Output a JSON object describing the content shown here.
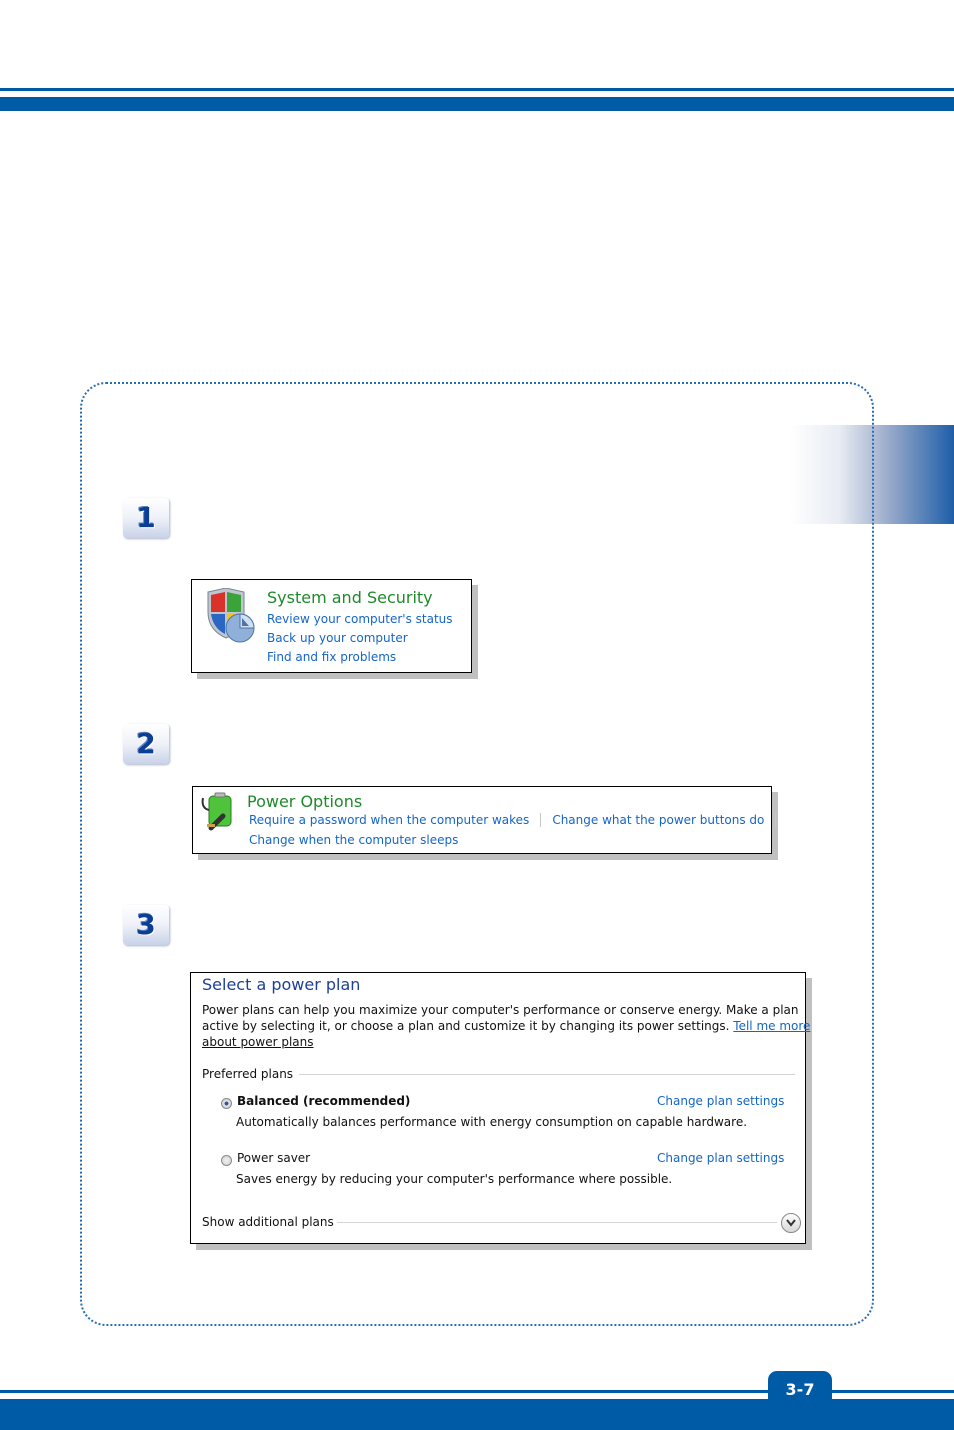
{
  "page": {
    "number": "3-7",
    "colors": {
      "brand_blue": "#005ba6",
      "link_blue": "#1565c7",
      "green_title": "#1e8a2a"
    }
  },
  "steps": [
    {
      "number": "1"
    },
    {
      "number": "2"
    },
    {
      "number": "3"
    }
  ],
  "system_security": {
    "title": "System and Security",
    "icon": "shield-icon",
    "links": [
      "Review your computer's status",
      "Back up your computer",
      "Find and fix problems"
    ]
  },
  "power_options": {
    "title": "Power Options",
    "icon": "battery-plug-icon",
    "links": [
      "Require a password when the computer wakes",
      "Change what the power buttons do",
      "Change when the computer sleeps"
    ]
  },
  "power_plan": {
    "title": "Select a power plan",
    "description_line1": "Power plans can help you maximize your computer's performance or conserve energy. Make a plan",
    "description_line2": "active by selecting it, or choose a plan and customize it by changing its power settings.",
    "tell_me_more_1": "Tell me more",
    "tell_me_more_2": "about power plans",
    "preferred_label": "Preferred plans",
    "plans": [
      {
        "name": "Balanced (recommended)",
        "selected": true,
        "description": "Automatically balances performance with energy consumption on capable hardware.",
        "settings_link": "Change plan settings"
      },
      {
        "name": "Power saver",
        "selected": false,
        "description": "Saves energy by reducing your computer's performance where possible.",
        "settings_link": "Change plan settings"
      }
    ],
    "show_additional": "Show additional plans"
  }
}
